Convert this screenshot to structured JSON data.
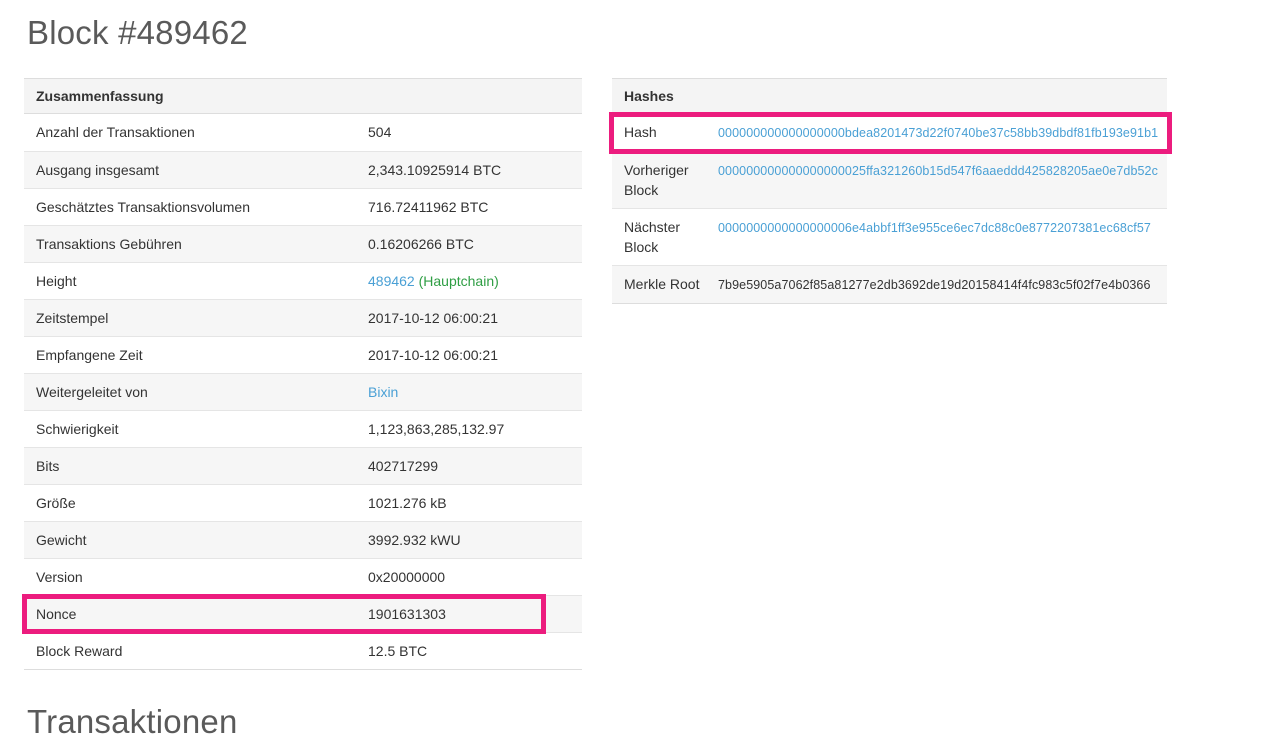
{
  "page": {
    "title": "Block #489462",
    "transactions_heading": "Transaktionen"
  },
  "colors": {
    "link": "#4aa0d5",
    "hauptchain_green": "#2f9e44",
    "highlight_pink": "#ec1c7e",
    "stripe": "#f6f6f6",
    "heading_bg": "#f4f4f4",
    "border": "#dddddd",
    "text": "#333333"
  },
  "summary": {
    "heading": "Zusammenfassung",
    "rows": [
      {
        "label": "Anzahl der Transaktionen",
        "value": "504",
        "link": false
      },
      {
        "label": "Ausgang insgesamt",
        "value": "2,343.10925914 BTC",
        "link": false
      },
      {
        "label": "Geschätztes Transaktionsvolumen",
        "value": "716.72411962 BTC",
        "link": false
      },
      {
        "label": "Transaktions Gebühren",
        "value": "0.16206266 BTC",
        "link": false
      },
      {
        "label": "Height",
        "value": "489462",
        "link": true,
        "suffix": "(Hauptchain)"
      },
      {
        "label": "Zeitstempel",
        "value": "2017-10-12 06:00:21",
        "link": false
      },
      {
        "label": "Empfangene Zeit",
        "value": "2017-10-12 06:00:21",
        "link": false
      },
      {
        "label": "Weitergeleitet von",
        "value": "Bixin",
        "link": true
      },
      {
        "label": "Schwierigkeit",
        "value": "1,123,863,285,132.97",
        "link": false
      },
      {
        "label": "Bits",
        "value": "402717299",
        "link": false
      },
      {
        "label": "Größe",
        "value": "1021.276 kB",
        "link": false
      },
      {
        "label": "Gewicht",
        "value": "3992.932 kWU",
        "link": false
      },
      {
        "label": "Version",
        "value": "0x20000000",
        "link": false
      },
      {
        "label": "Nonce",
        "value": "1901631303",
        "link": false,
        "highlighted": true
      },
      {
        "label": "Block Reward",
        "value": "12.5 BTC",
        "link": false
      }
    ]
  },
  "hashes": {
    "heading": "Hashes",
    "rows": [
      {
        "label": "Hash",
        "value": "000000000000000000bdea8201473d22f0740be37c58bb39dbdf81fb193e91b1",
        "link": true,
        "hash": true,
        "highlighted": true
      },
      {
        "label": "Vorheriger Block",
        "value": "000000000000000000025ffa321260b15d547f6aaeddd425828205ae0e7db52c",
        "link": true,
        "hash": true
      },
      {
        "label": "Nächster Block",
        "value": "0000000000000000006e4abbf1ff3e955ce6ec7dc88c0e8772207381ec68cf57",
        "link": true,
        "hash": true
      },
      {
        "label": "Merkle Root",
        "value": "7b9e5905a7062f85a81277e2db3692de19d20158414f4fc983c5f02f7e4b0366",
        "link": false,
        "hash": true
      }
    ]
  }
}
